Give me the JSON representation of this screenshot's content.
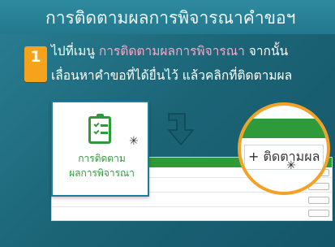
{
  "header": {
    "title": "การติดตามผลการพิจารณาคำขอฯ"
  },
  "step": {
    "number": "1"
  },
  "instruction": {
    "line1_prefix": "ไปที่เมนู ",
    "line1_highlight": "การติดตามผลการพิจารณา",
    "line1_suffix": " จากนั้น",
    "line2": "เลื่อนหาคำขอที่ได้ยื่นไว้ แล้วคลิกที่ติดตามผล"
  },
  "menu_card": {
    "label_line1": "การติดตาม",
    "label_line2": "ผลการพิจารณา"
  },
  "zoom": {
    "button_label": "+ ติดตามผล"
  },
  "colors": {
    "teal": "#1f6f84",
    "orange": "#f3a226",
    "green": "#2f9a3a",
    "pink": "#f5a8c7"
  }
}
